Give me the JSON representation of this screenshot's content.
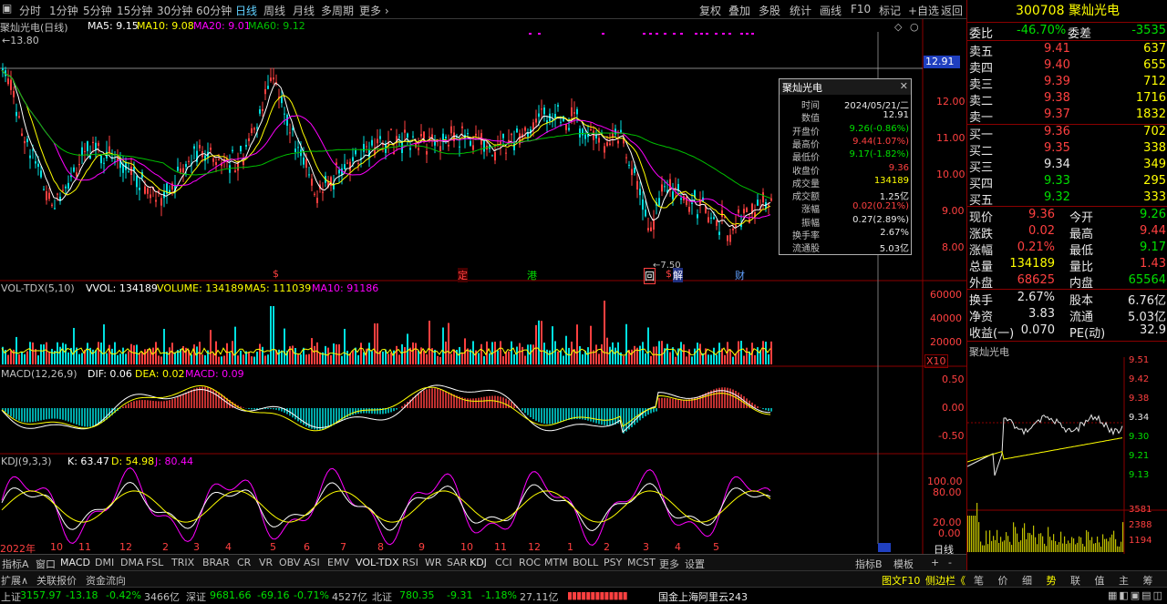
{
  "toolbar": {
    "left_icon": "menu-icon",
    "periods": [
      "分时",
      "1分钟",
      "5分钟",
      "15分钟",
      "30分钟",
      "60分钟",
      "日线",
      "周线",
      "月线",
      "多周期",
      "更多"
    ],
    "active_period": "日线",
    "right": [
      "复权",
      "叠加",
      "多股",
      "统计",
      "画线",
      "F10",
      "标记",
      "+自选",
      "返回"
    ]
  },
  "chart": {
    "title": "聚灿光电(日线)",
    "ma5": "MA5: 9.15",
    "ma10": "MA10: 9.08",
    "ma20": "MA20: 9.01",
    "ma60": "MA60: 9.12",
    "high_mark": "13.80",
    "low_mark": "7.50",
    "price_tag": "12.91",
    "price_axis": [
      "12.00",
      "11.00",
      "10.00",
      "9.00",
      "8.00"
    ],
    "events": [
      "$",
      "定",
      "港",
      "回",
      "$",
      "解",
      "财"
    ],
    "vol_title": "VOL-TDX(5,10)",
    "vvol": "VVOL: 134189",
    "volume": "VOLUME: 134189",
    "vol_ma5": "MA5: 111039",
    "vol_ma10": "MA10: 91186",
    "vol_axis": [
      "60000",
      "40000",
      "20000"
    ],
    "vol_unit": "X10",
    "macd_title": "MACD(12,26,9)",
    "dif": "DIF: 0.06",
    "dea": "DEA: 0.02",
    "macd": "MACD: 0.09",
    "macd_axis": [
      "0.50",
      "0.00",
      "-0.50"
    ],
    "kdj_title": "KDJ(9,3,3)",
    "k": "K: 63.47",
    "d": "D: 54.98",
    "j": "J: 80.44",
    "kdj_axis": [
      "100.00",
      "80.00",
      "20.00",
      "0.00"
    ],
    "time_axis": [
      "2022年",
      "10",
      "11",
      "12",
      "2",
      "3",
      "4",
      "5",
      "6",
      "7",
      "8",
      "9",
      "10",
      "11",
      "12",
      "1",
      "2",
      "3",
      "4",
      "5"
    ],
    "period_label": "日线"
  },
  "popup": {
    "title": "聚灿光电",
    "rows": [
      {
        "k": "时间",
        "v": "2024/05/21/二",
        "c": "#e8e8e8"
      },
      {
        "k": "数值",
        "v": "12.91",
        "c": "#e8e8e8"
      },
      {
        "k": "开盘价",
        "v": "9.26(-0.86%)",
        "c": "#00e000"
      },
      {
        "k": "最高价",
        "v": "9.44(1.07%)",
        "c": "#ff4040"
      },
      {
        "k": "最低价",
        "v": "9.17(-1.82%)",
        "c": "#00e000"
      },
      {
        "k": "收盘价",
        "v": "9.36",
        "c": "#ff4040"
      },
      {
        "k": "成交量",
        "v": "134189",
        "c": "#ffff00"
      },
      {
        "k": "成交额",
        "v": "1.25亿",
        "c": "#e8e8e8"
      },
      {
        "k": "涨幅",
        "v": "0.02(0.21%)",
        "c": "#ff4040"
      },
      {
        "k": "振幅",
        "v": "0.27(2.89%)",
        "c": "#e8e8e8"
      },
      {
        "k": "换手率",
        "v": "2.67%",
        "c": "#e8e8e8"
      },
      {
        "k": "流通股",
        "v": "5.03亿",
        "c": "#e8e8e8"
      }
    ]
  },
  "quote": {
    "code": "300708",
    "name": "聚灿光电",
    "wb_label": "委比",
    "wb": "-46.70%",
    "wc_label": "委差",
    "wc": "-3535",
    "asks": [
      {
        "l": "卖五",
        "p": "9.41",
        "v": "637"
      },
      {
        "l": "卖四",
        "p": "9.40",
        "v": "655"
      },
      {
        "l": "卖三",
        "p": "9.39",
        "v": "712"
      },
      {
        "l": "卖二",
        "p": "9.38",
        "v": "1716"
      },
      {
        "l": "卖一",
        "p": "9.37",
        "v": "1832"
      }
    ],
    "bids": [
      {
        "l": "买一",
        "p": "9.36",
        "v": "702"
      },
      {
        "l": "买二",
        "p": "9.35",
        "v": "338"
      },
      {
        "l": "买三",
        "p": "9.34",
        "v": "349"
      },
      {
        "l": "买四",
        "p": "9.33",
        "v": "295"
      },
      {
        "l": "买五",
        "p": "9.32",
        "v": "333"
      }
    ],
    "stats": [
      {
        "a": "现价",
        "av": "9.36",
        "b": "今开",
        "bv": "9.26"
      },
      {
        "a": "涨跌",
        "av": "0.02",
        "b": "最高",
        "bv": "9.44"
      },
      {
        "a": "涨幅",
        "av": "0.21%",
        "b": "最低",
        "bv": "9.17"
      },
      {
        "a": "总量",
        "av": "134189",
        "b": "量比",
        "bv": "1.43"
      },
      {
        "a": "外盘",
        "av": "68625",
        "b": "内盘",
        "bv": "65564"
      }
    ],
    "stats2": [
      {
        "a": "换手",
        "av": "2.67%",
        "b": "股本",
        "bv": "6.76亿"
      },
      {
        "a": "净资",
        "av": "3.83",
        "b": "流通",
        "bv": "5.03亿"
      },
      {
        "a": "收益(一)",
        "av": "0.070",
        "b": "PE(动)",
        "bv": "32.9"
      }
    ],
    "mini_title": "聚灿光电",
    "mini_axis": [
      "9.51",
      "9.42",
      "9.38",
      "9.34",
      "9.30",
      "9.21",
      "9.13"
    ],
    "mini_vol": [
      "3581",
      "2388",
      "1194"
    ],
    "mini_tabs": [
      "笔",
      "价",
      "细",
      "势",
      "联",
      "值",
      "主",
      "筹"
    ]
  },
  "tabs": {
    "left": [
      "指标A",
      "窗口",
      "MACD",
      "DMI",
      "DMA",
      "FSL",
      "TRIX",
      "BRAR",
      "CR",
      "VR",
      "OBV",
      "ASI",
      "EMV",
      "VOL-TDX",
      "RSI",
      "WR",
      "SAR",
      "KDJ",
      "CCI",
      "ROC",
      "MTM",
      "BOLL",
      "PSY",
      "MCST",
      "更多",
      "设置"
    ],
    "right": [
      "指标B",
      "模板",
      "+",
      "-"
    ]
  },
  "bottom": {
    "left": [
      "扩展∧",
      "关联报价",
      "资金流向"
    ],
    "right_link": "图文F10",
    "right_text": "侧边栏《"
  },
  "status": {
    "sh_label": "上证",
    "sh": "3157.97",
    "sh_chg": "-13.18",
    "sh_pct": "-0.42%",
    "sh_amt": "3466亿",
    "sz_label": "深证",
    "sz": "9681.66",
    "sz_chg": "-69.16",
    "sz_pct": "-0.71%",
    "sz_amt": "4527亿",
    "bz_label": "北证",
    "bz": "780.35",
    "bz_chg": "-9.31",
    "bz_pct": "-1.18%",
    "bz_amt": "27.11亿",
    "server": "国金上海阿里云243"
  },
  "colors": {
    "up": "#ff4040",
    "down": "#00e0e0",
    "ma5": "#ffffff",
    "ma10": "#ffff00",
    "ma20": "#ff00ff",
    "ma60": "#00c000"
  }
}
